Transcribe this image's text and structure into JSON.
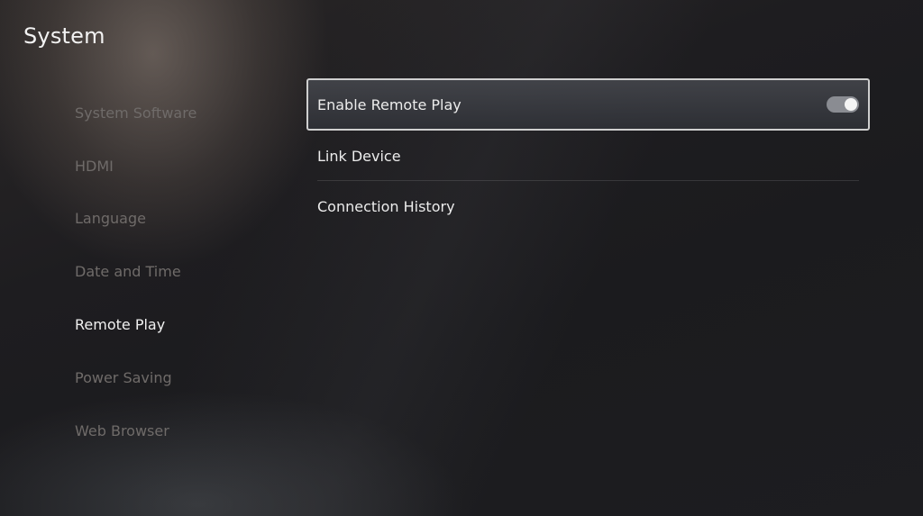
{
  "header": {
    "title": "System"
  },
  "sidebar": {
    "items": [
      {
        "label": "System Software",
        "active": false
      },
      {
        "label": "HDMI",
        "active": false
      },
      {
        "label": "Language",
        "active": false
      },
      {
        "label": "Date and Time",
        "active": false
      },
      {
        "label": "Remote Play",
        "active": true
      },
      {
        "label": "Power Saving",
        "active": false
      },
      {
        "label": "Web Browser",
        "active": false
      }
    ]
  },
  "main": {
    "items": [
      {
        "label": "Enable Remote Play",
        "toggle": true,
        "toggle_on": true
      },
      {
        "label": "Link Device"
      },
      {
        "label": "Connection History"
      }
    ]
  },
  "colors": {
    "background": "#1c1c1f",
    "active_text": "#f0f0f0",
    "inactive_text": "#6f6b69",
    "selection_border": "#cfcfcf",
    "toggle_track": "#8a8c92"
  }
}
